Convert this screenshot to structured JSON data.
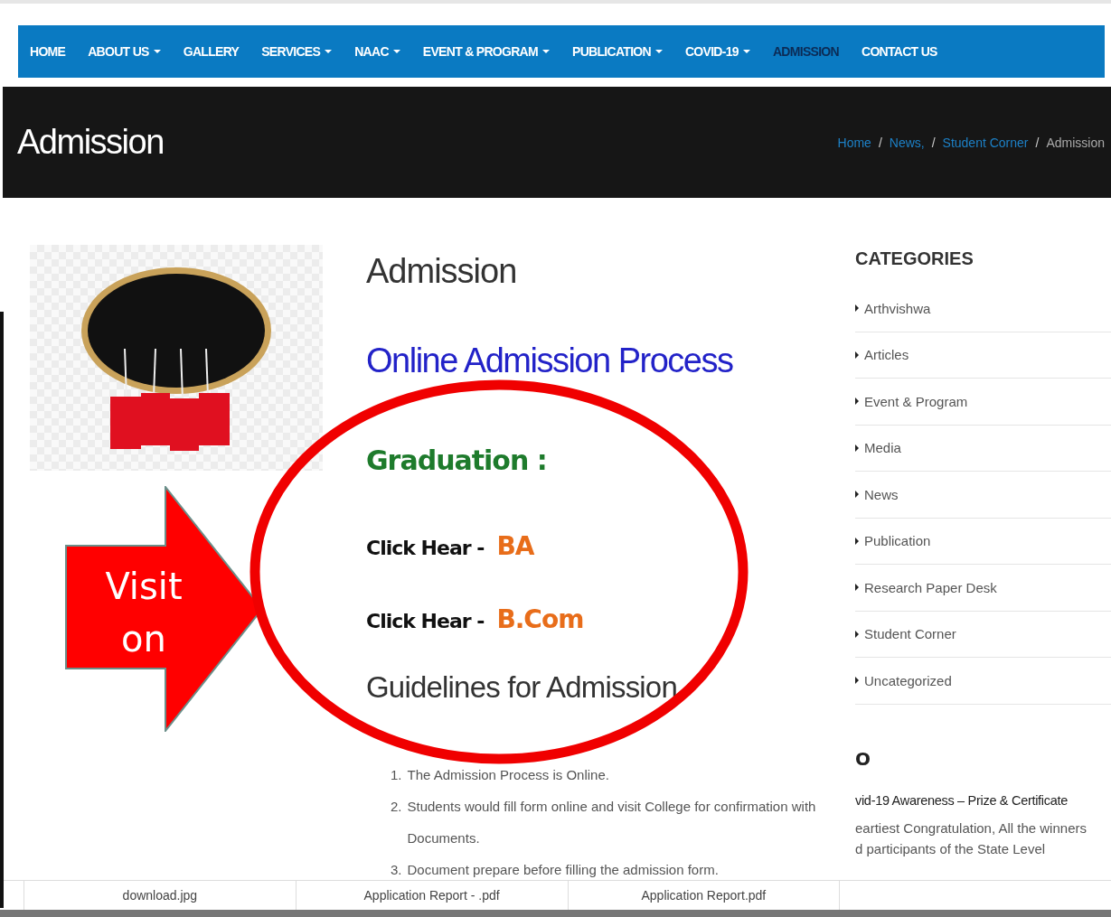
{
  "nav": {
    "items": [
      {
        "label": "HOME",
        "dropdown": false,
        "selected": false
      },
      {
        "label": "ABOUT US",
        "dropdown": true,
        "selected": false
      },
      {
        "label": "GALLERY",
        "dropdown": false,
        "selected": false
      },
      {
        "label": "SERVICES",
        "dropdown": true,
        "selected": false
      },
      {
        "label": "NAAC",
        "dropdown": true,
        "selected": false
      },
      {
        "label": "EVENT & PROGRAM",
        "dropdown": true,
        "selected": false
      },
      {
        "label": "PUBLICATION",
        "dropdown": true,
        "selected": false
      },
      {
        "label": "COVID-19",
        "dropdown": true,
        "selected": false
      },
      {
        "label": "ADMISSION",
        "dropdown": false,
        "selected": true
      },
      {
        "label": "CONTACT US",
        "dropdown": false,
        "selected": false
      }
    ]
  },
  "banner": {
    "title": "Admission",
    "separator": "/",
    "breadcrumb": [
      {
        "label": "Home",
        "link": true
      },
      {
        "label": "News,",
        "link": true
      },
      {
        "label": "Student Corner",
        "link": true
      },
      {
        "label": "Admission",
        "link": false
      }
    ]
  },
  "annotation": {
    "arrow_label": "Visit on"
  },
  "content": {
    "title": "Admission",
    "subtitle": "Online Admission Process",
    "section": "Graduation :",
    "links": [
      {
        "prefix": "Click Hear -",
        "label": "BA"
      },
      {
        "prefix": "Click Hear -",
        "label": "B.Com"
      }
    ],
    "guidelines_title": "Guidelines for Admission",
    "guidelines": [
      {
        "number": "1.",
        "text": "The Admission Process is Online."
      },
      {
        "number": "2.",
        "text": "Students would fill form online and visit College for confirmation with Documents."
      },
      {
        "number": "3.",
        "text": "Document prepare before filling the admission form."
      }
    ]
  },
  "sidebar": {
    "heading": "CATEGORIES",
    "categories": [
      "Arthvishwa",
      "Articles",
      "Event & Program",
      "Media",
      "News",
      "Publication",
      "Research Paper Desk",
      "Student Corner",
      "Uncategorized"
    ],
    "recent_heading": "O",
    "post_title": "vid-19 Awareness – Prize & Certificate",
    "excerpt": [
      "eartiest Congratulation, All the winners",
      "d participants of the State Level"
    ]
  },
  "attachments": [
    "download.jpg",
    "Application Report - .pdf",
    "Application Report.pdf"
  ]
}
